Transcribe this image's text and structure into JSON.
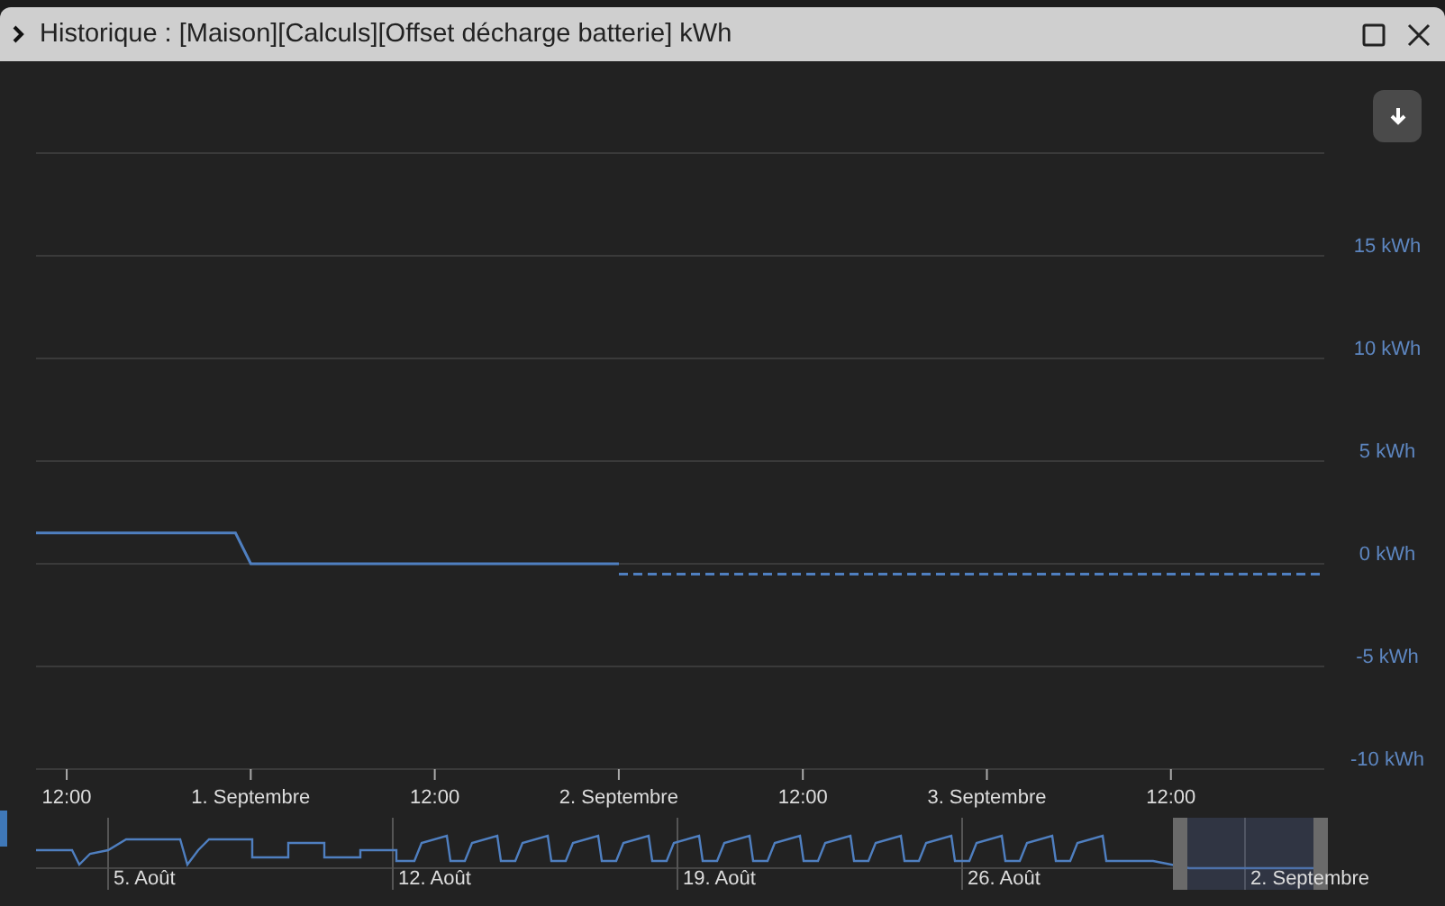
{
  "window": {
    "title": "Historique : [Maison][Calculs][Offset décharge batterie] kWh"
  },
  "chart_data": {
    "type": "line",
    "grid": true,
    "ylim": [
      -10,
      20
    ],
    "categories": [
      null,
      null,
      "12:00",
      null,
      null,
      null,
      null,
      null,
      null,
      null,
      null,
      null,
      null,
      null,
      "1. Septembre",
      null,
      null,
      null,
      null,
      null,
      null,
      null,
      null,
      null,
      null,
      null,
      "12:00",
      null,
      null,
      null,
      null,
      null,
      null,
      null,
      null,
      null,
      null,
      null,
      "2. Septembre",
      null,
      null,
      null,
      null,
      null,
      null,
      null,
      null,
      null,
      null,
      null,
      "12:00",
      null,
      null,
      null,
      null,
      null,
      null,
      null,
      null,
      null,
      null,
      null,
      "3. Septembre",
      null,
      null,
      null,
      null,
      null,
      null,
      null,
      null,
      null,
      null,
      null,
      "12:00",
      null,
      null,
      null,
      null,
      null,
      null,
      null,
      null,
      null,
      null
    ],
    "yticks": [
      {
        "value": -10,
        "label": "-10 kWh"
      },
      {
        "value": -5,
        "label": "-5 kWh"
      },
      {
        "value": 0,
        "label": "0 kWh"
      },
      {
        "value": 5,
        "label": "5 kWh"
      },
      {
        "value": 10,
        "label": "10 kWh"
      },
      {
        "value": 15,
        "label": "15 kWh"
      }
    ],
    "series": [
      {
        "color": "#4f7fc0",
        "line_style": "solid",
        "values": [
          1.5,
          1.5,
          1.5,
          1.5,
          1.5,
          1.5,
          1.5,
          1.5,
          1.5,
          1.5,
          1.5,
          1.5,
          1.5,
          1.5,
          0,
          0,
          0,
          0,
          0,
          0,
          0,
          0,
          0,
          0,
          0,
          0,
          0,
          0,
          0,
          0,
          0,
          0,
          0,
          0,
          0,
          0,
          0,
          0,
          0,
          null,
          null,
          null,
          null,
          null,
          null,
          null,
          null,
          null,
          null,
          null,
          null,
          null,
          null,
          null,
          null,
          null,
          null,
          null,
          null,
          null,
          null,
          null,
          null,
          null,
          null,
          null,
          null,
          null,
          null,
          null,
          null,
          null,
          null,
          null,
          null,
          null,
          null,
          null,
          null,
          null,
          null,
          null,
          null,
          null,
          null
        ]
      },
      {
        "color": "#4f7fc0",
        "line_style": "dashed",
        "values": [
          null,
          null,
          null,
          null,
          null,
          null,
          null,
          null,
          null,
          null,
          null,
          null,
          null,
          null,
          null,
          null,
          null,
          null,
          null,
          null,
          null,
          null,
          null,
          null,
          null,
          null,
          null,
          null,
          null,
          null,
          null,
          null,
          null,
          null,
          null,
          null,
          null,
          null,
          -0.5,
          -0.5,
          -0.5,
          -0.5,
          -0.5,
          -0.5,
          -0.5,
          -0.5,
          -0.5,
          -0.5,
          -0.5,
          -0.5,
          -0.5,
          -0.5,
          -0.5,
          -0.5,
          -0.5,
          -0.5,
          -0.5,
          -0.5,
          -0.5,
          -0.5,
          -0.5,
          -0.5,
          -0.5,
          -0.5,
          -0.5,
          -0.5,
          -0.5,
          -0.5,
          -0.5,
          -0.5,
          -0.5,
          -0.5,
          -0.5,
          -0.5,
          -0.5,
          -0.5,
          -0.5,
          -0.5,
          -0.5,
          -0.5,
          -0.5,
          -0.5,
          -0.5,
          -0.5,
          -0.5
        ]
      }
    ]
  },
  "navigator": {
    "labels": [
      "5. Août",
      "12. Août",
      "19. Août",
      "26. Août",
      "2. Septembre"
    ]
  }
}
